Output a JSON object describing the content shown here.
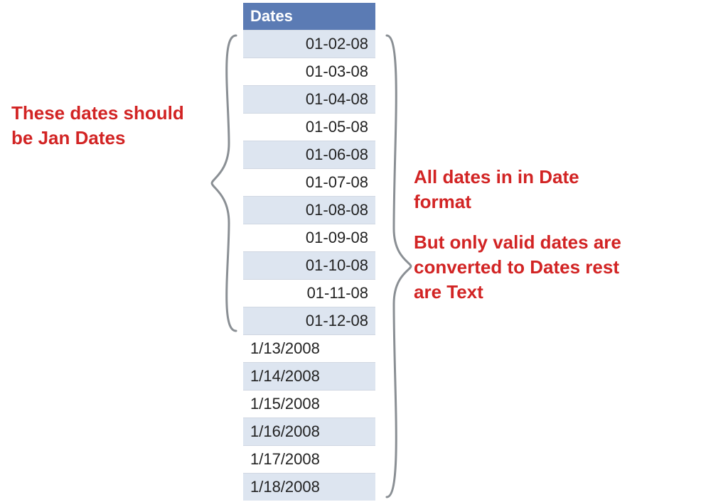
{
  "colors": {
    "header_bg": "#5B7BB4",
    "row_alt_bg": "#DDE5F0",
    "callout_red": "#D22424",
    "brace_gray": "#8A8F94"
  },
  "table": {
    "header": "Dates",
    "rows": [
      {
        "value": "01-02-08",
        "align": "right"
      },
      {
        "value": "01-03-08",
        "align": "right"
      },
      {
        "value": "01-04-08",
        "align": "right"
      },
      {
        "value": "01-05-08",
        "align": "right"
      },
      {
        "value": "01-06-08",
        "align": "right"
      },
      {
        "value": "01-07-08",
        "align": "right"
      },
      {
        "value": "01-08-08",
        "align": "right"
      },
      {
        "value": "01-09-08",
        "align": "right"
      },
      {
        "value": "01-10-08",
        "align": "right"
      },
      {
        "value": "01-11-08",
        "align": "right"
      },
      {
        "value": "01-12-08",
        "align": "right"
      },
      {
        "value": "1/13/2008",
        "align": "left"
      },
      {
        "value": "1/14/2008",
        "align": "left"
      },
      {
        "value": "1/15/2008",
        "align": "left"
      },
      {
        "value": "1/16/2008",
        "align": "left"
      },
      {
        "value": "1/17/2008",
        "align": "left"
      },
      {
        "value": "1/18/2008",
        "align": "left"
      }
    ]
  },
  "callouts": {
    "left_line1": "These dates should",
    "left_line2": "be Jan Dates",
    "right_line1": "All dates in in Date",
    "right_line2": "format",
    "right_line3": "But only valid dates are",
    "right_line4": "converted to Dates rest",
    "right_line5": "are Text"
  }
}
